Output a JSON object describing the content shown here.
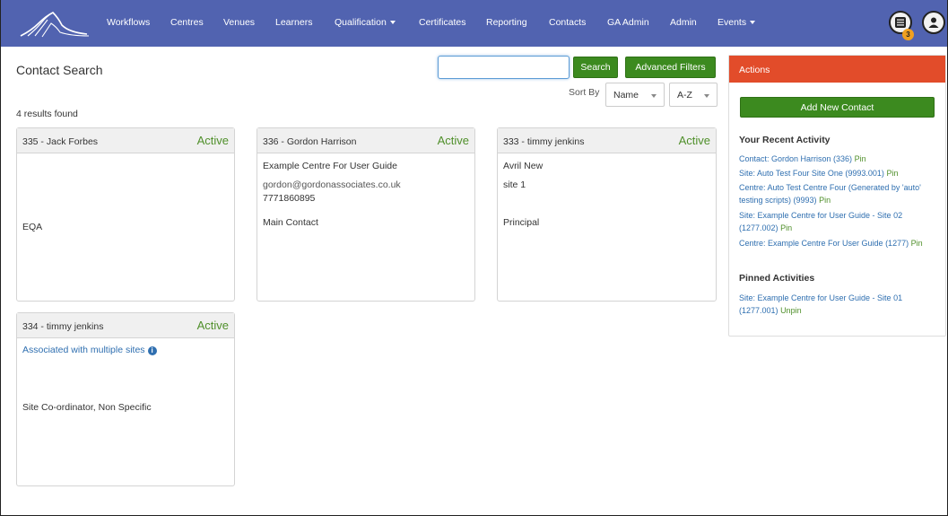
{
  "nav": {
    "items": [
      "Workflows",
      "Centres",
      "Venues",
      "Learners",
      "Qualification",
      "Certificates",
      "Reporting",
      "Contacts",
      "GA Admin",
      "Admin",
      "Events"
    ],
    "notification_count": "3"
  },
  "page": {
    "title": "Contact Search",
    "search_value": "",
    "search_button": "Search",
    "advanced_button": "Advanced Filters",
    "sort_by_label": "Sort By",
    "sort_field": "Name",
    "sort_order": "A-Z",
    "results_text": "4 results found"
  },
  "cards": [
    {
      "title": "335 - Jack Forbes",
      "status": "Active",
      "role": "EQA"
    },
    {
      "title": "336 - Gordon Harrison",
      "status": "Active",
      "centre": "Example Centre For User Guide",
      "email": "gordon@gordonassociates.co.uk",
      "phone": "7771860895",
      "role": "Main Contact"
    },
    {
      "title": "333 - timmy jenkins",
      "status": "Active",
      "centre": "Avril New",
      "site": "site 1",
      "role": "Principal"
    },
    {
      "title": "334 - timmy jenkins",
      "status": "Active",
      "note": "Associated with multiple sites",
      "role": "Site Co-ordinator, Non Specific"
    }
  ],
  "actions": {
    "header": "Actions",
    "add_button": "Add New Contact",
    "recent_title": "Your Recent Activity",
    "recent": [
      {
        "text": "Contact: Gordon Harrison (336)",
        "action": "Pin"
      },
      {
        "text": "Site: Auto Test Four Site One (9993.001)",
        "action": "Pin"
      },
      {
        "text": "Centre: Auto Test Centre Four (Generated by 'auto' testing scripts) (9993)",
        "action": "Pin"
      },
      {
        "text": "Site: Example Centre for User Guide - Site 02 (1277.002)",
        "action": "Pin"
      },
      {
        "text": "Centre: Example Centre For User Guide (1277)",
        "action": "Pin"
      }
    ],
    "pinned_title": "Pinned Activities",
    "pinned": [
      {
        "text": "Site: Example Centre for User Guide - Site 01 (1277.001)",
        "action": "Unpin"
      }
    ]
  },
  "colors": {
    "navbar": "#5163b0",
    "accent_green": "#3c8a1f",
    "actions_header": "#e24c2a",
    "link_blue": "#2f6fb0",
    "status_green": "#4f8f2a"
  },
  "icons": [
    "mountain-logo-icon",
    "caret-down-icon",
    "list-icon",
    "user-icon",
    "info-icon"
  ]
}
